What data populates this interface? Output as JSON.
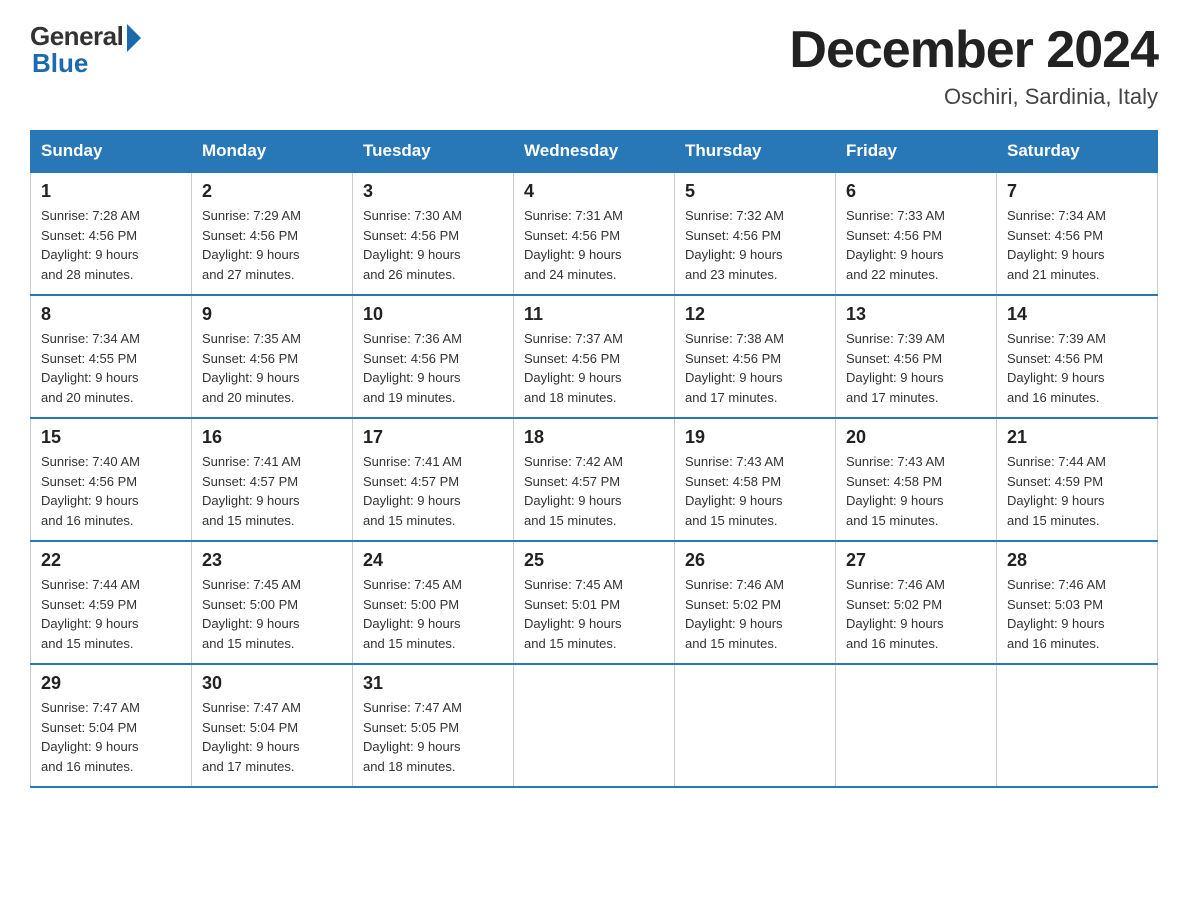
{
  "header": {
    "logo_general": "General",
    "logo_blue": "Blue",
    "title": "December 2024",
    "subtitle": "Oschiri, Sardinia, Italy"
  },
  "weekdays": [
    "Sunday",
    "Monday",
    "Tuesday",
    "Wednesday",
    "Thursday",
    "Friday",
    "Saturday"
  ],
  "weeks": [
    [
      {
        "day": "1",
        "sunrise": "7:28 AM",
        "sunset": "4:56 PM",
        "daylight": "9 hours and 28 minutes."
      },
      {
        "day": "2",
        "sunrise": "7:29 AM",
        "sunset": "4:56 PM",
        "daylight": "9 hours and 27 minutes."
      },
      {
        "day": "3",
        "sunrise": "7:30 AM",
        "sunset": "4:56 PM",
        "daylight": "9 hours and 26 minutes."
      },
      {
        "day": "4",
        "sunrise": "7:31 AM",
        "sunset": "4:56 PM",
        "daylight": "9 hours and 24 minutes."
      },
      {
        "day": "5",
        "sunrise": "7:32 AM",
        "sunset": "4:56 PM",
        "daylight": "9 hours and 23 minutes."
      },
      {
        "day": "6",
        "sunrise": "7:33 AM",
        "sunset": "4:56 PM",
        "daylight": "9 hours and 22 minutes."
      },
      {
        "day": "7",
        "sunrise": "7:34 AM",
        "sunset": "4:56 PM",
        "daylight": "9 hours and 21 minutes."
      }
    ],
    [
      {
        "day": "8",
        "sunrise": "7:34 AM",
        "sunset": "4:55 PM",
        "daylight": "9 hours and 20 minutes."
      },
      {
        "day": "9",
        "sunrise": "7:35 AM",
        "sunset": "4:56 PM",
        "daylight": "9 hours and 20 minutes."
      },
      {
        "day": "10",
        "sunrise": "7:36 AM",
        "sunset": "4:56 PM",
        "daylight": "9 hours and 19 minutes."
      },
      {
        "day": "11",
        "sunrise": "7:37 AM",
        "sunset": "4:56 PM",
        "daylight": "9 hours and 18 minutes."
      },
      {
        "day": "12",
        "sunrise": "7:38 AM",
        "sunset": "4:56 PM",
        "daylight": "9 hours and 17 minutes."
      },
      {
        "day": "13",
        "sunrise": "7:39 AM",
        "sunset": "4:56 PM",
        "daylight": "9 hours and 17 minutes."
      },
      {
        "day": "14",
        "sunrise": "7:39 AM",
        "sunset": "4:56 PM",
        "daylight": "9 hours and 16 minutes."
      }
    ],
    [
      {
        "day": "15",
        "sunrise": "7:40 AM",
        "sunset": "4:56 PM",
        "daylight": "9 hours and 16 minutes."
      },
      {
        "day": "16",
        "sunrise": "7:41 AM",
        "sunset": "4:57 PM",
        "daylight": "9 hours and 15 minutes."
      },
      {
        "day": "17",
        "sunrise": "7:41 AM",
        "sunset": "4:57 PM",
        "daylight": "9 hours and 15 minutes."
      },
      {
        "day": "18",
        "sunrise": "7:42 AM",
        "sunset": "4:57 PM",
        "daylight": "9 hours and 15 minutes."
      },
      {
        "day": "19",
        "sunrise": "7:43 AM",
        "sunset": "4:58 PM",
        "daylight": "9 hours and 15 minutes."
      },
      {
        "day": "20",
        "sunrise": "7:43 AM",
        "sunset": "4:58 PM",
        "daylight": "9 hours and 15 minutes."
      },
      {
        "day": "21",
        "sunrise": "7:44 AM",
        "sunset": "4:59 PM",
        "daylight": "9 hours and 15 minutes."
      }
    ],
    [
      {
        "day": "22",
        "sunrise": "7:44 AM",
        "sunset": "4:59 PM",
        "daylight": "9 hours and 15 minutes."
      },
      {
        "day": "23",
        "sunrise": "7:45 AM",
        "sunset": "5:00 PM",
        "daylight": "9 hours and 15 minutes."
      },
      {
        "day": "24",
        "sunrise": "7:45 AM",
        "sunset": "5:00 PM",
        "daylight": "9 hours and 15 minutes."
      },
      {
        "day": "25",
        "sunrise": "7:45 AM",
        "sunset": "5:01 PM",
        "daylight": "9 hours and 15 minutes."
      },
      {
        "day": "26",
        "sunrise": "7:46 AM",
        "sunset": "5:02 PM",
        "daylight": "9 hours and 15 minutes."
      },
      {
        "day": "27",
        "sunrise": "7:46 AM",
        "sunset": "5:02 PM",
        "daylight": "9 hours and 16 minutes."
      },
      {
        "day": "28",
        "sunrise": "7:46 AM",
        "sunset": "5:03 PM",
        "daylight": "9 hours and 16 minutes."
      }
    ],
    [
      {
        "day": "29",
        "sunrise": "7:47 AM",
        "sunset": "5:04 PM",
        "daylight": "9 hours and 16 minutes."
      },
      {
        "day": "30",
        "sunrise": "7:47 AM",
        "sunset": "5:04 PM",
        "daylight": "9 hours and 17 minutes."
      },
      {
        "day": "31",
        "sunrise": "7:47 AM",
        "sunset": "5:05 PM",
        "daylight": "9 hours and 18 minutes."
      },
      null,
      null,
      null,
      null
    ]
  ],
  "labels": {
    "sunrise": "Sunrise:",
    "sunset": "Sunset:",
    "daylight": "Daylight:"
  }
}
